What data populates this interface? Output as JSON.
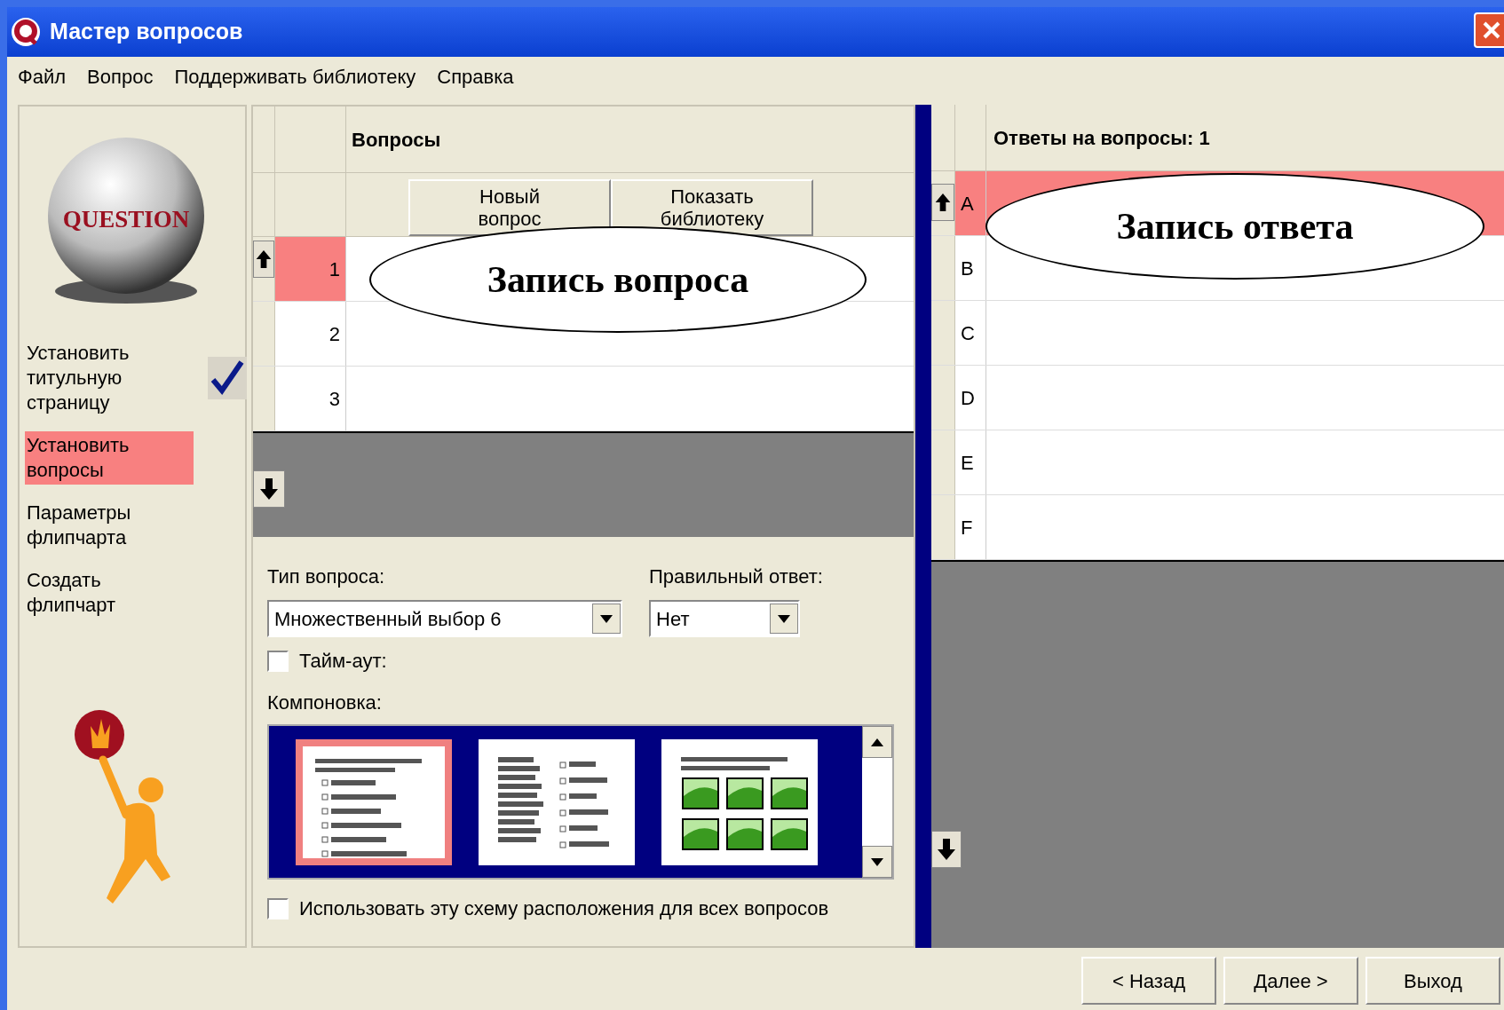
{
  "window": {
    "title": "Мастер вопросов"
  },
  "menu": [
    "Файл",
    "Вопрос",
    "Поддерживать библиотеку",
    "Справка"
  ],
  "sidebar": {
    "logo_text": "QUESTION",
    "steps": [
      {
        "label": "Установить титульную страницу",
        "selected": false,
        "done": true
      },
      {
        "label": "Установить вопросы",
        "selected": true,
        "done": false
      },
      {
        "label": "Параметры флипчарта",
        "selected": false,
        "done": false
      },
      {
        "label": "Создать флипчарт",
        "selected": false,
        "done": false
      }
    ]
  },
  "questions": {
    "header": "Вопросы",
    "buttons": [
      "Новый вопрос",
      "Показать библиотеку"
    ],
    "rows": [
      {
        "number": "1",
        "selected": true
      },
      {
        "number": "2",
        "selected": false
      },
      {
        "number": "3",
        "selected": false
      }
    ]
  },
  "form": {
    "question_type": {
      "label": "Тип вопроса:",
      "value": "Множественный выбор 6"
    },
    "correct_answer": {
      "label": "Правильный ответ:",
      "value": "Нет"
    },
    "timeout": {
      "label": "Тайм-аут:",
      "checked": false
    },
    "layout_label": "Компоновка:",
    "layouts": [
      {
        "kind": "list",
        "selected": true
      },
      {
        "kind": "columns",
        "selected": false
      },
      {
        "kind": "images",
        "selected": false
      }
    ],
    "use_for_all": {
      "label": "Использовать эту схему расположения для всех вопросов",
      "checked": false
    }
  },
  "answers": {
    "header": "Ответы на вопросы: 1",
    "rows": [
      {
        "letter": "A",
        "selected": true
      },
      {
        "letter": "B",
        "selected": false
      },
      {
        "letter": "C",
        "selected": false
      },
      {
        "letter": "D",
        "selected": false
      },
      {
        "letter": "E",
        "selected": false
      },
      {
        "letter": "F",
        "selected": false
      }
    ]
  },
  "footer_buttons": [
    "< Назад",
    "Далее >",
    "Выход"
  ],
  "callouts": [
    "Запись вопроса",
    "Запись ответа"
  ]
}
